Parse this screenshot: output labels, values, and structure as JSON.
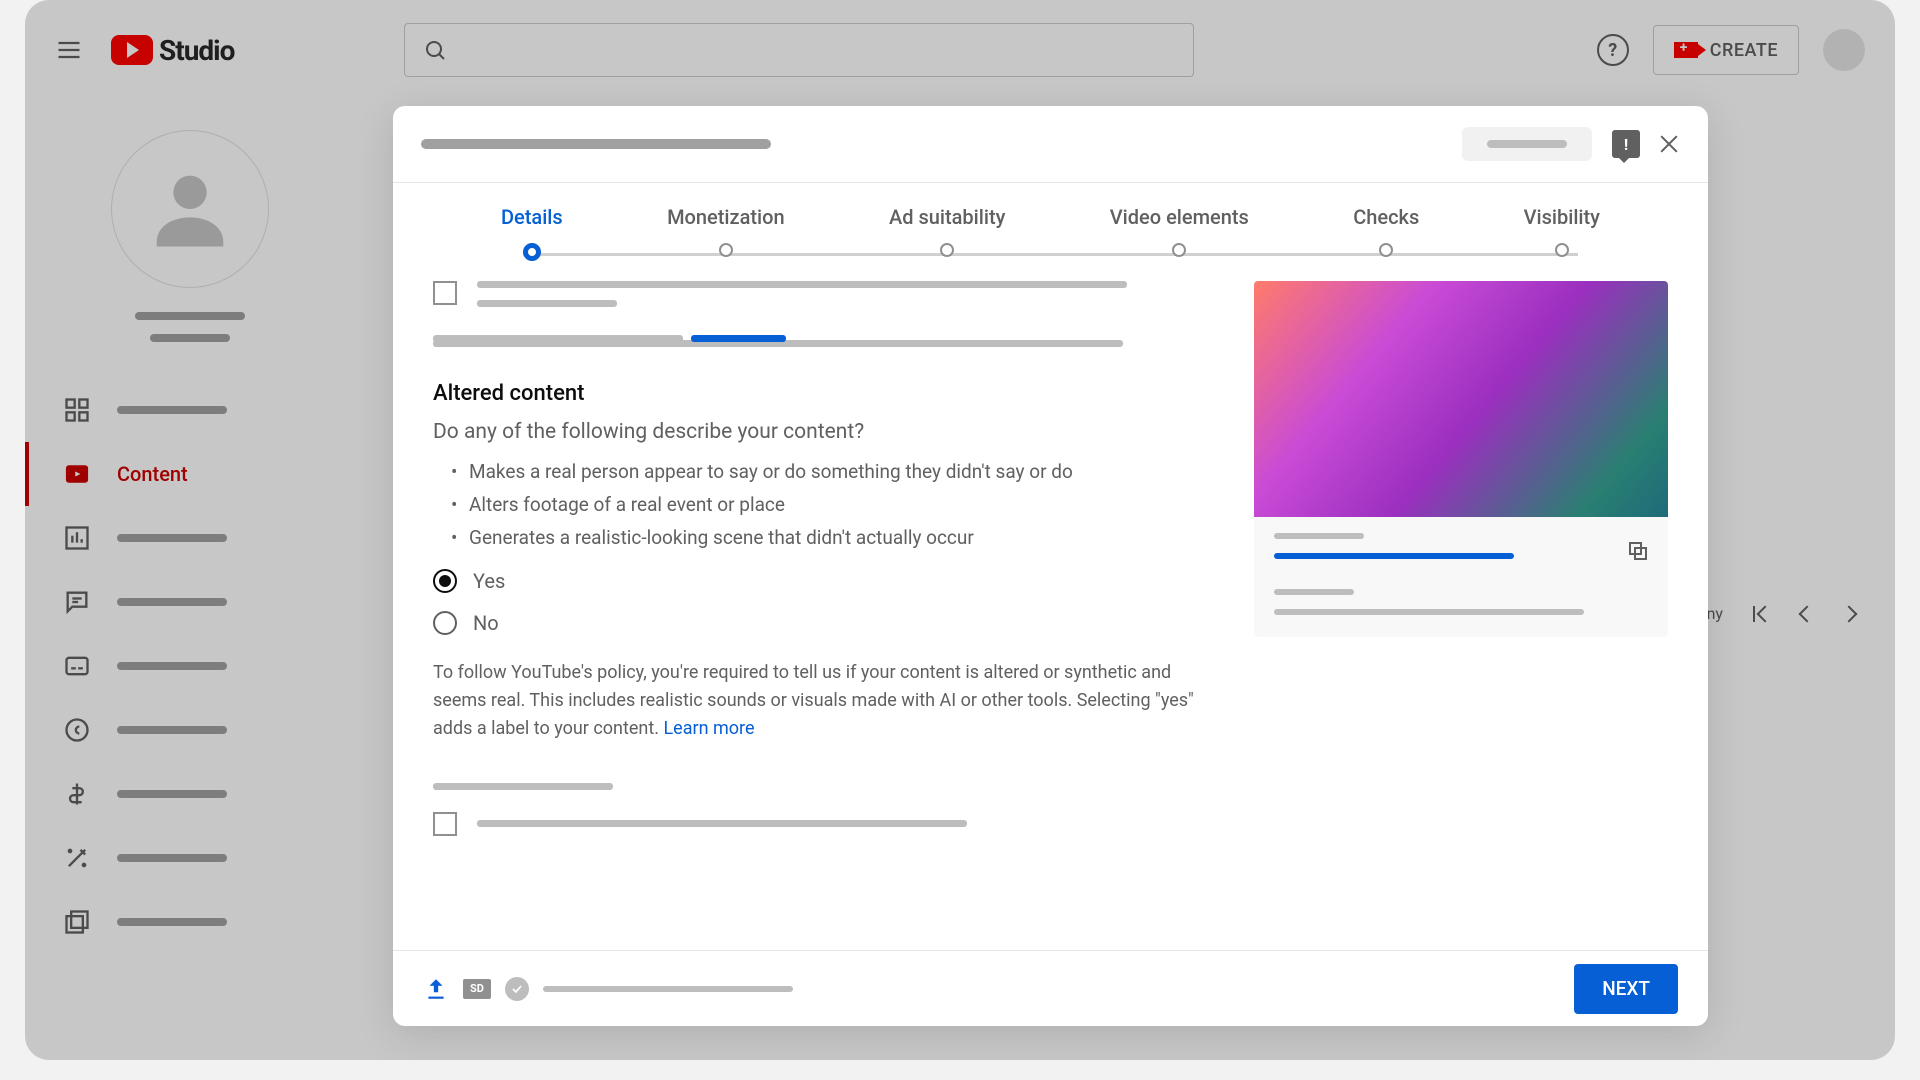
{
  "header": {
    "logo_text": "Studio",
    "create_label": "CREATE",
    "help_label": "?"
  },
  "sidebar": {
    "active_label": "Content"
  },
  "stepper": {
    "steps": [
      "Details",
      "Monetization",
      "Ad suitability",
      "Video elements",
      "Checks",
      "Visibility"
    ]
  },
  "altered": {
    "title": "Altered content",
    "question": "Do any of the following describe your content?",
    "bullets": [
      "Makes a real person appear to say or do something they didn't say or do",
      "Alters footage of a real event or place",
      "Generates a realistic-looking scene that didn't actually occur"
    ],
    "yes_label": "Yes",
    "no_label": "No",
    "policy": "To follow YouTube's policy, you're required to tell us if your content is altered or synthetic and seems real. This includes realistic sounds or visuals made with AI or other tools. Selecting \"yes\" adds a label to your content. ",
    "learn_more": "Learn more"
  },
  "pager": {
    "rows_fragment": "ny"
  },
  "footer": {
    "sd_label": "SD",
    "next_label": "NEXT"
  }
}
